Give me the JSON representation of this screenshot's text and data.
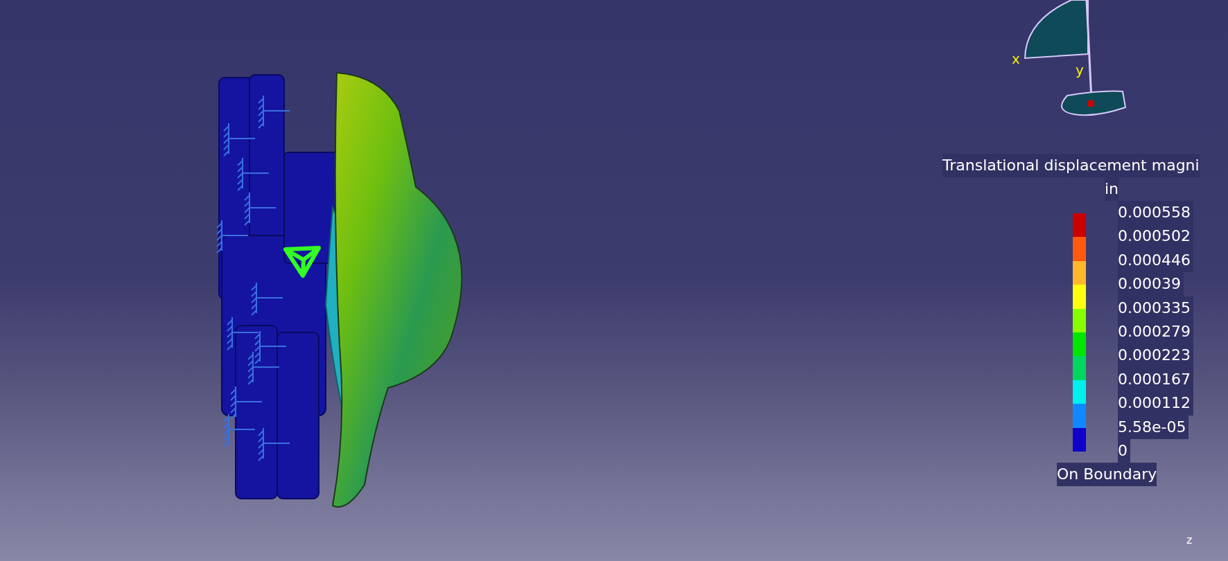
{
  "compass": {
    "x_label": "x",
    "y_label": "y"
  },
  "legend": {
    "title": "Translational displacement magni",
    "unit": "in",
    "labels": [
      "0.000558",
      "0.000502",
      "0.000446",
      "0.00039",
      "0.000335",
      "0.000279",
      "0.000223",
      "0.000167",
      "0.000112",
      "5.58e-05",
      "0"
    ],
    "bands": [
      {
        "color": "#cc0000"
      },
      {
        "color": "#ff5a10"
      },
      {
        "color": "#ffb82c"
      },
      {
        "color": "#ffff10"
      },
      {
        "color": "#88ff00"
      },
      {
        "color": "#00e600"
      },
      {
        "color": "#00d660"
      },
      {
        "color": "#00f0ee"
      },
      {
        "color": "#1088ff"
      },
      {
        "color": "#1000cc"
      }
    ],
    "footer": "On Boundary"
  },
  "axis": {
    "z_label": "z"
  }
}
